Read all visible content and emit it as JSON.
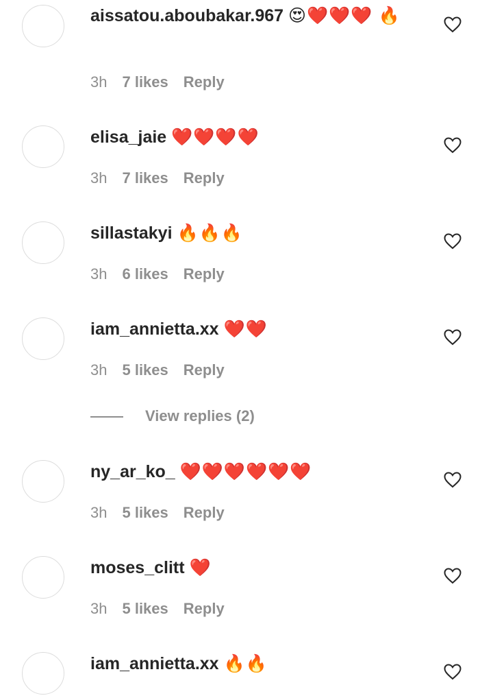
{
  "comments": [
    {
      "username": "aissatou.aboubakar.967",
      "emoji": "😍❤️❤️❤️ 🔥",
      "time": "3h",
      "likes": "7 likes",
      "reply": "Reply"
    },
    {
      "username": "elisa_jaie",
      "emoji": "❤️❤️❤️❤️",
      "time": "3h",
      "likes": "7 likes",
      "reply": "Reply"
    },
    {
      "username": "sillastakyi",
      "emoji": "🔥🔥🔥",
      "time": "3h",
      "likes": "6 likes",
      "reply": "Reply"
    },
    {
      "username": "iam_annietta.xx",
      "emoji": "❤️❤️",
      "time": "3h",
      "likes": "5 likes",
      "reply": "Reply"
    },
    {
      "username": "ny_ar_ko_",
      "emoji": "❤️❤️❤️❤️❤️❤️",
      "time": "3h",
      "likes": "5 likes",
      "reply": "Reply"
    },
    {
      "username": "moses_clitt",
      "emoji": "❤️",
      "time": "3h",
      "likes": "5 likes",
      "reply": "Reply"
    },
    {
      "username": "iam_annietta.xx",
      "emoji": "🔥🔥",
      "time": "",
      "likes": "",
      "reply": ""
    }
  ],
  "view_replies": {
    "label": "View replies (2)"
  },
  "icons": {
    "like": "heart-outline-icon"
  }
}
